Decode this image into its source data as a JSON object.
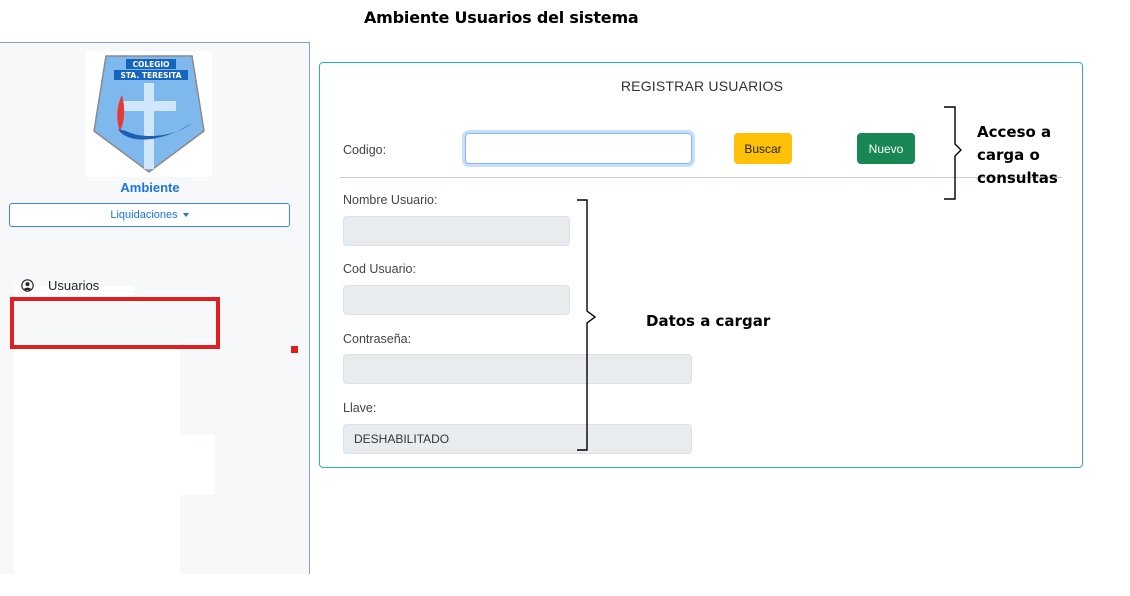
{
  "doc_title": "Ambiente Usuarios del sistema",
  "sidebar": {
    "logo_line1": "COLEGIO",
    "logo_line2": "STA. TERESITA",
    "brand": "Ambiente",
    "dropdown_label": "Liquidaciones",
    "nav_items": [
      {
        "label": "Usuarios",
        "icon": "user-circle-icon"
      }
    ]
  },
  "form": {
    "title": "REGISTRAR USUARIOS",
    "codigo_label": "Codigo:",
    "codigo_value": "",
    "buscar_label": "Buscar",
    "nuevo_label": "Nuevo",
    "nombre_label": "Nombre Usuario:",
    "nombre_value": "",
    "cod_usuario_label": "Cod Usuario:",
    "cod_usuario_value": "",
    "contrasena_label": "Contraseña:",
    "contrasena_value": "",
    "llave_label": "Llave:",
    "llave_value": "DESHABILITADO"
  },
  "annotations": {
    "acceso_line1": "Acceso a",
    "acceso_line2": "carga o",
    "acceso_line3": "consultas",
    "datos": "Datos a cargar"
  },
  "colors": {
    "primary": "#1a73e8",
    "card_border": "#2ab0b8",
    "buscar": "#ffc107",
    "nuevo": "#198754",
    "highlight": "#e02020"
  }
}
